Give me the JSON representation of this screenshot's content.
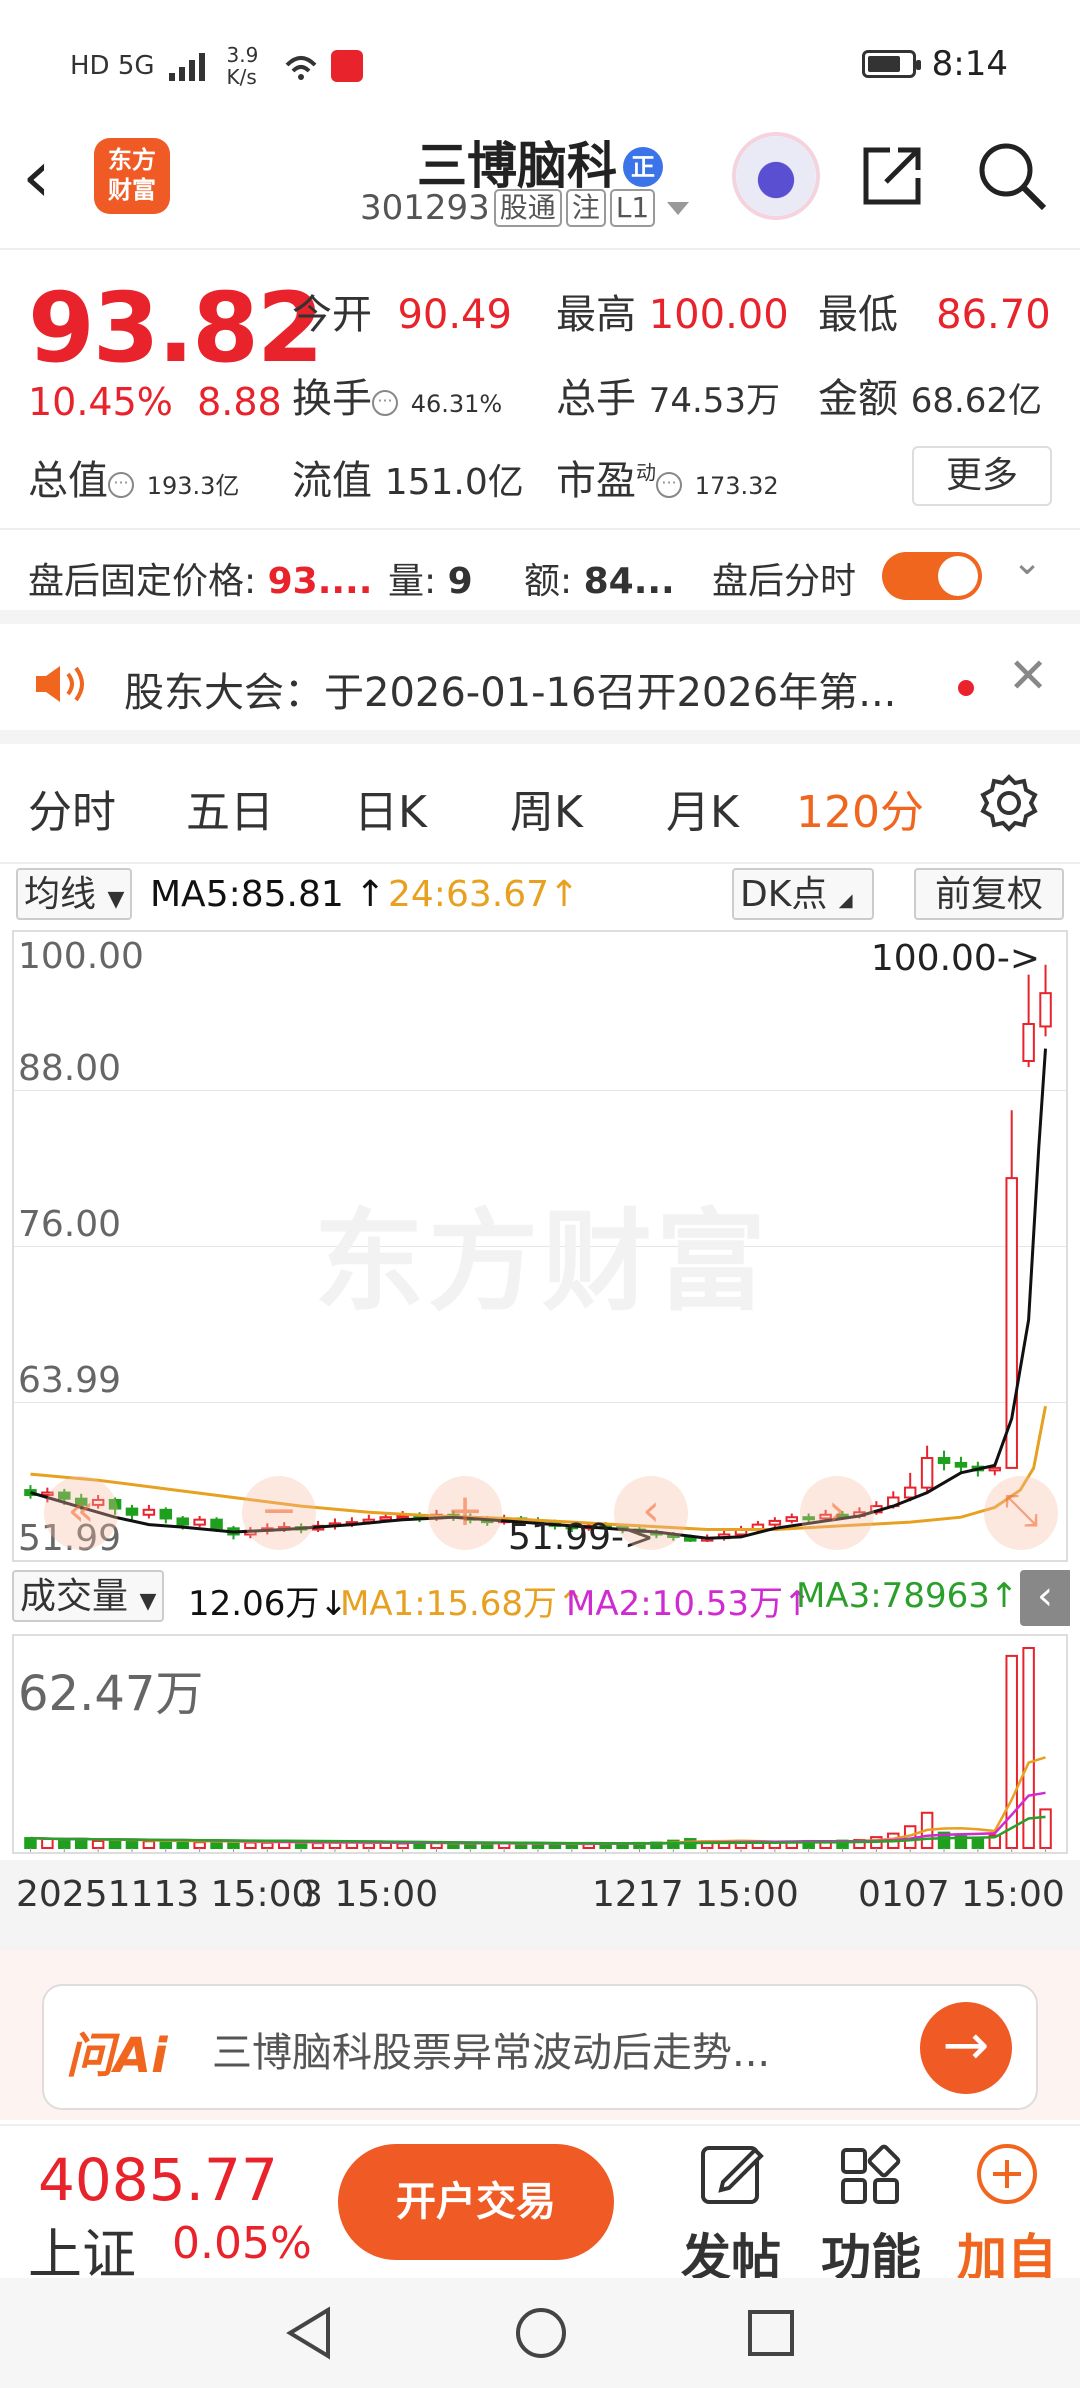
{
  "status": {
    "net": "HD 5G",
    "speed": "3.9 K/s",
    "time": "8:14"
  },
  "header": {
    "back": "‹",
    "logo": "东方\n财富",
    "title": "三博脑科",
    "title_badge": "正",
    "code": "301293",
    "tags": [
      "股通",
      "注",
      "L1"
    ]
  },
  "quote": {
    "price": "93.82",
    "change_pct": "10.45%",
    "change_amt": "8.88",
    "open_label": "今开",
    "open": "90.49",
    "high_label": "最高",
    "high": "100.00",
    "low_label": "最低",
    "low": "86.70",
    "turnover_label": "换手",
    "turnover": "46.31%",
    "volume_label": "总手",
    "volume": "74.53万",
    "amount_label": "金额",
    "amount": "68.62亿",
    "mktcap_label": "总值",
    "mktcap": "193.3亿",
    "float_label": "流值",
    "float": "151.0亿",
    "pe_label": "市盈",
    "pe_sup": "动",
    "pe": "173.32",
    "more": "更多"
  },
  "after_hours": {
    "price_label": "盘后固定价格:",
    "price": "93....",
    "vol_label": "量:",
    "vol": "9",
    "amt_label": "额:",
    "amt": "84...",
    "toggle_label": "盘后分时"
  },
  "notice": {
    "text": "股东大会：于2026-01-16召开2026年第..."
  },
  "tabs": [
    {
      "label": "分时",
      "active": false
    },
    {
      "label": "五日",
      "active": false
    },
    {
      "label": "日K",
      "active": false
    },
    {
      "label": "周K",
      "active": false
    },
    {
      "label": "月K",
      "active": false
    },
    {
      "label": "120分",
      "active": true
    }
  ],
  "chart_header": {
    "indicator": "均线",
    "ma5": "MA5:85.81 ↑",
    "ma24": "24:63.67↑",
    "dk": "DK点",
    "adjust": "前复权"
  },
  "chart_data": {
    "type": "candlestick",
    "y_ticks": [
      "100.00",
      "88.00",
      "76.00",
      "63.99",
      "51.99"
    ],
    "ylim": [
      51.99,
      100.0
    ],
    "max_label": "100.00->",
    "min_label": "51.99->",
    "watermark": "东方财富",
    "ma_colors": {
      "ma5": "#111111",
      "ma24": "#e8a020"
    },
    "up_color": "#e8232b",
    "down_color": "#1ea01e",
    "candles": [
      [
        56.2,
        55.8,
        56.6,
        55.5
      ],
      [
        55.8,
        56.0,
        56.4,
        55.2
      ],
      [
        56.0,
        55.5,
        56.3,
        55.0
      ],
      [
        55.5,
        55.0,
        55.9,
        54.6
      ],
      [
        55.0,
        55.4,
        55.8,
        54.7
      ],
      [
        55.4,
        54.7,
        55.6,
        54.2
      ],
      [
        54.7,
        54.2,
        55.0,
        53.8
      ],
      [
        54.2,
        54.6,
        55.0,
        53.9
      ],
      [
        54.6,
        53.9,
        54.8,
        53.5
      ],
      [
        53.9,
        53.4,
        54.1,
        53.0
      ],
      [
        53.4,
        53.8,
        54.1,
        53.2
      ],
      [
        53.8,
        53.1,
        54.0,
        52.8
      ],
      [
        53.1,
        52.6,
        53.3,
        52.2
      ],
      [
        52.6,
        52.9,
        53.2,
        52.3
      ],
      [
        52.9,
        53.1,
        53.5,
        52.6
      ],
      [
        53.1,
        53.2,
        53.6,
        52.8
      ],
      [
        53.2,
        53.0,
        53.5,
        52.7
      ],
      [
        53.0,
        53.3,
        53.7,
        52.8
      ],
      [
        53.3,
        53.5,
        53.9,
        53.0
      ],
      [
        53.5,
        53.6,
        54.0,
        53.2
      ],
      [
        53.6,
        53.8,
        54.2,
        53.4
      ],
      [
        53.8,
        54.0,
        54.4,
        53.6
      ],
      [
        54.0,
        54.1,
        54.5,
        53.7
      ],
      [
        54.1,
        53.9,
        54.4,
        53.6
      ],
      [
        53.9,
        54.2,
        54.6,
        53.7
      ],
      [
        54.2,
        54.0,
        54.5,
        53.7
      ],
      [
        54.0,
        53.8,
        54.3,
        53.5
      ],
      [
        53.8,
        53.6,
        54.1,
        53.3
      ],
      [
        53.6,
        53.9,
        54.2,
        53.4
      ],
      [
        53.9,
        53.7,
        54.1,
        53.4
      ],
      [
        53.7,
        53.5,
        54.0,
        53.2
      ],
      [
        53.5,
        53.3,
        53.8,
        53.0
      ],
      [
        53.3,
        53.1,
        53.6,
        52.8
      ],
      [
        53.1,
        53.3,
        53.6,
        52.9
      ],
      [
        53.3,
        53.2,
        53.6,
        52.9
      ],
      [
        53.2,
        53.0,
        53.4,
        52.7
      ],
      [
        53.0,
        52.8,
        53.3,
        52.5
      ],
      [
        52.8,
        52.6,
        53.0,
        52.3
      ],
      [
        52.6,
        52.4,
        52.8,
        52.1
      ],
      [
        52.4,
        52.1,
        52.6,
        51.99
      ],
      [
        52.1,
        52.3,
        52.6,
        51.99
      ],
      [
        52.3,
        52.6,
        52.9,
        52.1
      ],
      [
        52.6,
        53.0,
        53.3,
        52.4
      ],
      [
        53.0,
        53.4,
        53.7,
        52.8
      ],
      [
        53.4,
        53.7,
        54.0,
        53.2
      ],
      [
        53.7,
        54.0,
        54.3,
        53.5
      ],
      [
        54.0,
        53.9,
        54.3,
        53.6
      ],
      [
        53.9,
        54.2,
        54.6,
        53.7
      ],
      [
        54.2,
        54.1,
        54.5,
        53.8
      ],
      [
        54.1,
        54.4,
        54.8,
        53.9
      ],
      [
        54.4,
        54.9,
        55.3,
        54.2
      ],
      [
        54.9,
        55.6,
        56.1,
        54.7
      ],
      [
        55.6,
        56.4,
        57.6,
        55.3
      ],
      [
        56.4,
        58.8,
        59.8,
        56.1
      ],
      [
        58.8,
        58.4,
        59.4,
        57.8
      ],
      [
        58.4,
        58.1,
        58.9,
        57.5
      ],
      [
        58.1,
        57.8,
        58.5,
        57.3
      ],
      [
        57.8,
        58.0,
        58.4,
        57.4
      ],
      [
        58.0,
        81.5,
        87.0,
        77.0
      ],
      [
        91.0,
        94.0,
        98.0,
        90.5
      ],
      [
        93.8,
        96.5,
        98.8,
        93.0
      ]
    ],
    "ma5": [
      [
        56.0,
        0
      ],
      [
        55.6,
        1
      ],
      [
        55.2,
        2
      ],
      [
        54.8,
        3
      ],
      [
        54.4,
        4
      ],
      [
        54.0,
        5
      ],
      [
        53.7,
        6
      ],
      [
        53.4,
        7
      ],
      [
        53.2,
        9
      ],
      [
        52.8,
        12
      ],
      [
        53.0,
        15
      ],
      [
        53.4,
        19
      ],
      [
        53.8,
        22
      ],
      [
        54.0,
        25
      ],
      [
        53.7,
        28
      ],
      [
        53.4,
        31
      ],
      [
        53.1,
        34
      ],
      [
        52.8,
        37
      ],
      [
        52.3,
        40
      ],
      [
        52.4,
        42
      ],
      [
        53.1,
        44
      ],
      [
        53.7,
        47
      ],
      [
        54.1,
        49
      ],
      [
        54.9,
        51
      ],
      [
        56.0,
        53
      ],
      [
        57.6,
        55
      ],
      [
        58.2,
        57
      ],
      [
        62.0,
        58
      ],
      [
        70.0,
        59
      ],
      [
        84.0,
        59.6
      ],
      [
        92.0,
        60
      ]
    ],
    "ma24": [
      [
        57.5,
        0
      ],
      [
        57.0,
        4
      ],
      [
        56.3,
        8
      ],
      [
        55.6,
        12
      ],
      [
        54.9,
        16
      ],
      [
        54.4,
        20
      ],
      [
        54.1,
        24
      ],
      [
        53.9,
        28
      ],
      [
        53.6,
        32
      ],
      [
        53.3,
        36
      ],
      [
        53.0,
        40
      ],
      [
        53.0,
        44
      ],
      [
        53.3,
        48
      ],
      [
        53.6,
        52
      ],
      [
        54.0,
        55
      ],
      [
        54.8,
        57
      ],
      [
        56.2,
        58.5
      ],
      [
        58.0,
        59.3
      ],
      [
        63.0,
        60
      ]
    ]
  },
  "overlay_buttons": [
    "«",
    "−",
    "+",
    "‹",
    "›",
    "⤡"
  ],
  "volume_header": {
    "indicator": "成交量",
    "value": "12.06万↓",
    "ma1": "MA1:15.68万↑",
    "ma2": "MA2:10.53万↑",
    "ma3": "MA3:78963↑",
    "collapse": "‹"
  },
  "volume_chart": {
    "max_label": "62.47万",
    "max_value_wan": 62.47,
    "colors": {
      "ma1": "#e8a020",
      "ma2": "#d02bd0",
      "ma3": "#2aa02a"
    },
    "bars_wan": [
      3.1,
      2.8,
      2.5,
      2.9,
      2.2,
      2.6,
      2.4,
      2.1,
      2.0,
      2.3,
      1.8,
      2.2,
      1.9,
      1.7,
      1.6,
      1.8,
      2.0,
      1.5,
      1.6,
      1.7,
      1.5,
      1.9,
      1.4,
      1.6,
      1.5,
      1.3,
      1.4,
      1.6,
      1.5,
      1.3,
      1.2,
      1.4,
      1.3,
      1.2,
      1.5,
      1.4,
      1.6,
      1.7,
      2.3,
      2.8,
      2.1,
      1.9,
      2.2,
      1.8,
      1.9,
      2.0,
      2.2,
      1.9,
      2.3,
      2.5,
      3.4,
      4.5,
      6.8,
      11.0,
      4.8,
      3.6,
      3.2,
      3.9,
      60.0,
      62.47,
      12.06
    ]
  },
  "dates": [
    "20251113 15:00",
    "3 15:00",
    "1217 15:00",
    "0107 15:00"
  ],
  "ai": {
    "logo": "问Ai",
    "text": "三博脑科股票异常波动后走势..."
  },
  "bottom": {
    "index_value": "4085.77",
    "index_name": "上证",
    "index_pct": "0.05%",
    "open_btn": "开户交易",
    "post": "发帖",
    "func": "功能",
    "add": "加自"
  }
}
